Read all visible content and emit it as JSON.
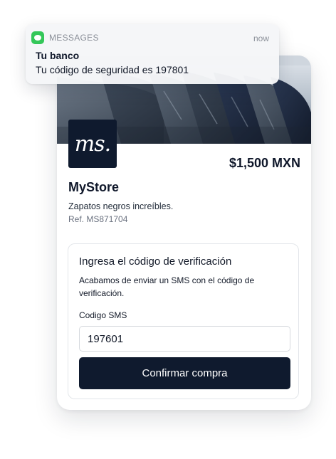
{
  "notification": {
    "app_name": "MESSAGES",
    "time": "now",
    "title": "Tu banco",
    "body": "Tu código de seguridad es 197801",
    "icon": "messages-icon",
    "icon_color": "#34c759"
  },
  "product": {
    "logo_text": "ms.",
    "price": "$1,500 MXN",
    "store_name": "MyStore",
    "description": "Zapatos negros increíbles.",
    "reference": "Ref. MS871704",
    "brand_color": "#0f1a2e"
  },
  "verification": {
    "title": "Ingresa el código de verificación",
    "instructions": "Acabamos de enviar un SMS con el código de verificación.",
    "sms_label": "Codigo SMS",
    "sms_value": "197601",
    "confirm_label": "Confirmar compra"
  }
}
